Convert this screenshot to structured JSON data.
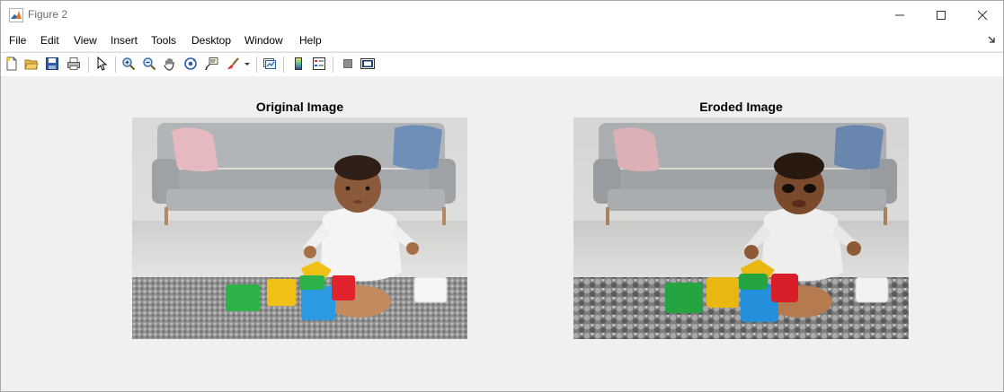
{
  "window": {
    "title": "Figure 2"
  },
  "menu": {
    "items": [
      "File",
      "Edit",
      "View",
      "Insert",
      "Tools",
      "Desktop",
      "Window",
      "Help"
    ]
  },
  "toolbar": {
    "buttons": [
      "new-figure-icon",
      "open-icon",
      "save-icon",
      "print-icon",
      "pointer-icon",
      "zoom-in-icon",
      "zoom-out-icon",
      "pan-icon",
      "rotate-3d-icon",
      "data-tips-icon",
      "brush-icon",
      "link-plot-icon",
      "colorbar-icon",
      "legend-icon",
      "hide-plot-tools-icon",
      "show-plot-tools-icon"
    ]
  },
  "figure": {
    "left_axes": {
      "title": "Original Image"
    },
    "right_axes": {
      "title": "Eroded Image"
    }
  }
}
